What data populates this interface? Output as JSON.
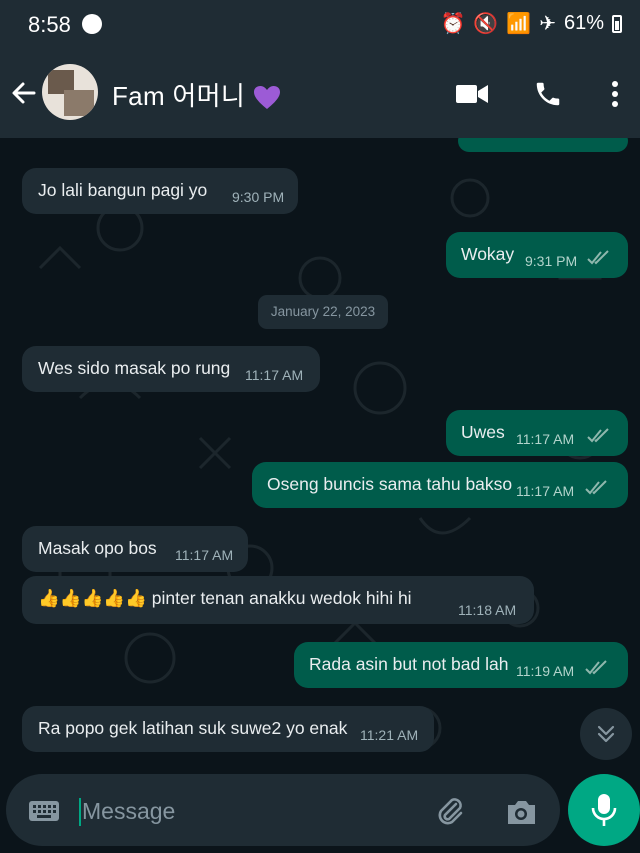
{
  "status_bar": {
    "time": "8:58",
    "battery": "61%"
  },
  "header": {
    "contact_name": "Fam 어머니"
  },
  "date_divider": "January 22, 2023",
  "messages": [
    {
      "text": "Jo lali bangun  pagi yo",
      "time": "9:30 PM"
    },
    {
      "text": "Wokay",
      "time": "9:31 PM"
    },
    {
      "text": "Wes sido masak po rung",
      "time": "11:17 AM"
    },
    {
      "text": "Uwes",
      "time": "11:17 AM"
    },
    {
      "text": "Oseng buncis sama tahu bakso",
      "time": "11:17 AM"
    },
    {
      "text": "Masak opo bos",
      "time": "11:17 AM"
    },
    {
      "text": "👍👍👍👍👍 pinter tenan anakku wedok hihi hi",
      "time": "11:18 AM"
    },
    {
      "text": "Rada asin but not bad lah",
      "time": "11:19 AM"
    },
    {
      "text": "Ra popo gek latihan suk suwe2 yo enak",
      "time": "11:21 AM"
    }
  ],
  "composer": {
    "placeholder": "Message"
  },
  "colors": {
    "incoming": "#1f2c34",
    "outgoing": "#005c4b",
    "accent": "#00a884",
    "background": "#0b141a"
  }
}
